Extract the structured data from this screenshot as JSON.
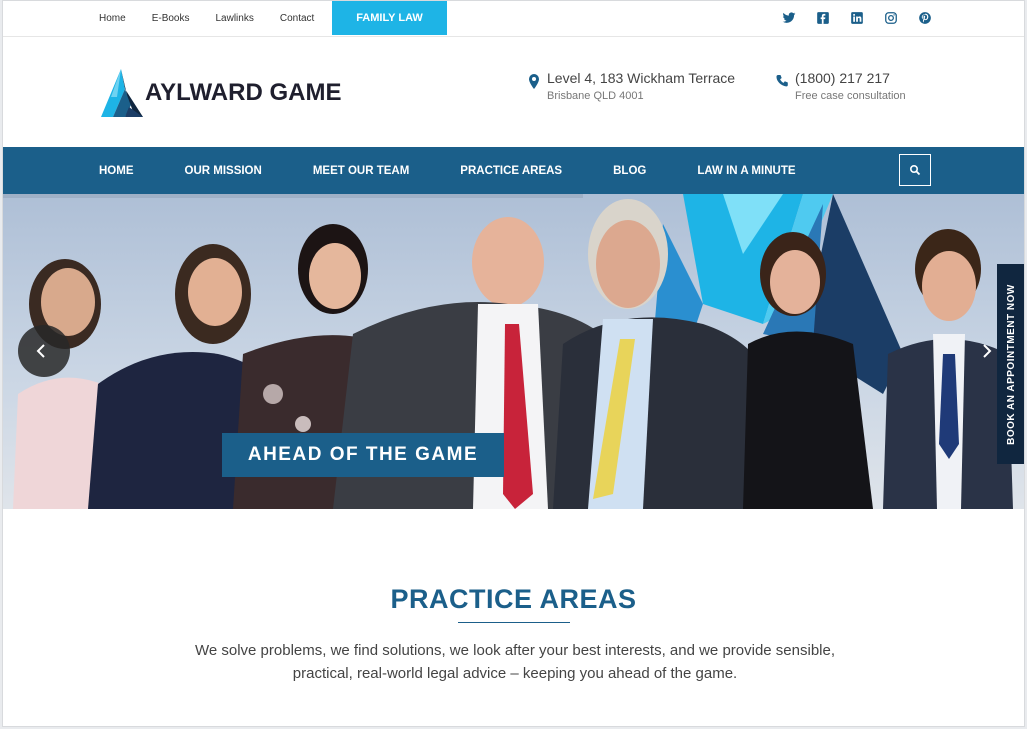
{
  "topbar": {
    "links": [
      "Home",
      "E-Books",
      "Lawlinks",
      "Contact"
    ],
    "family_button": "FAMILY LAW",
    "social_icons": [
      "twitter-icon",
      "facebook-icon",
      "linkedin-icon",
      "instagram-icon",
      "pinterest-icon"
    ]
  },
  "header": {
    "logo_text": "AYLWARD GAME",
    "address_line1": "Level 4, 183 Wickham Terrace",
    "address_line2": "Brisbane QLD 4001",
    "phone": "(1800) 217 217",
    "phone_note": "Free case consultation"
  },
  "nav": {
    "items": [
      "HOME",
      "OUR MISSION",
      "MEET OUR TEAM",
      "PRACTICE AREAS",
      "BLOG",
      "LAW IN A MINUTE"
    ]
  },
  "hero": {
    "tagline": "AHEAD OF THE GAME",
    "book_tab": "BOOK AN APPOINTMENT NOW"
  },
  "practice": {
    "title": "PRACTICE AREAS",
    "description": "We solve problems, we find solutions, we look after your best interests, and we provide sensible, practical, real-world legal advice – keeping you ahead of the game."
  },
  "colors": {
    "brand_blue": "#1b5f8a",
    "accent_cyan": "#1eb4e6",
    "dark_navy": "#10263f"
  }
}
